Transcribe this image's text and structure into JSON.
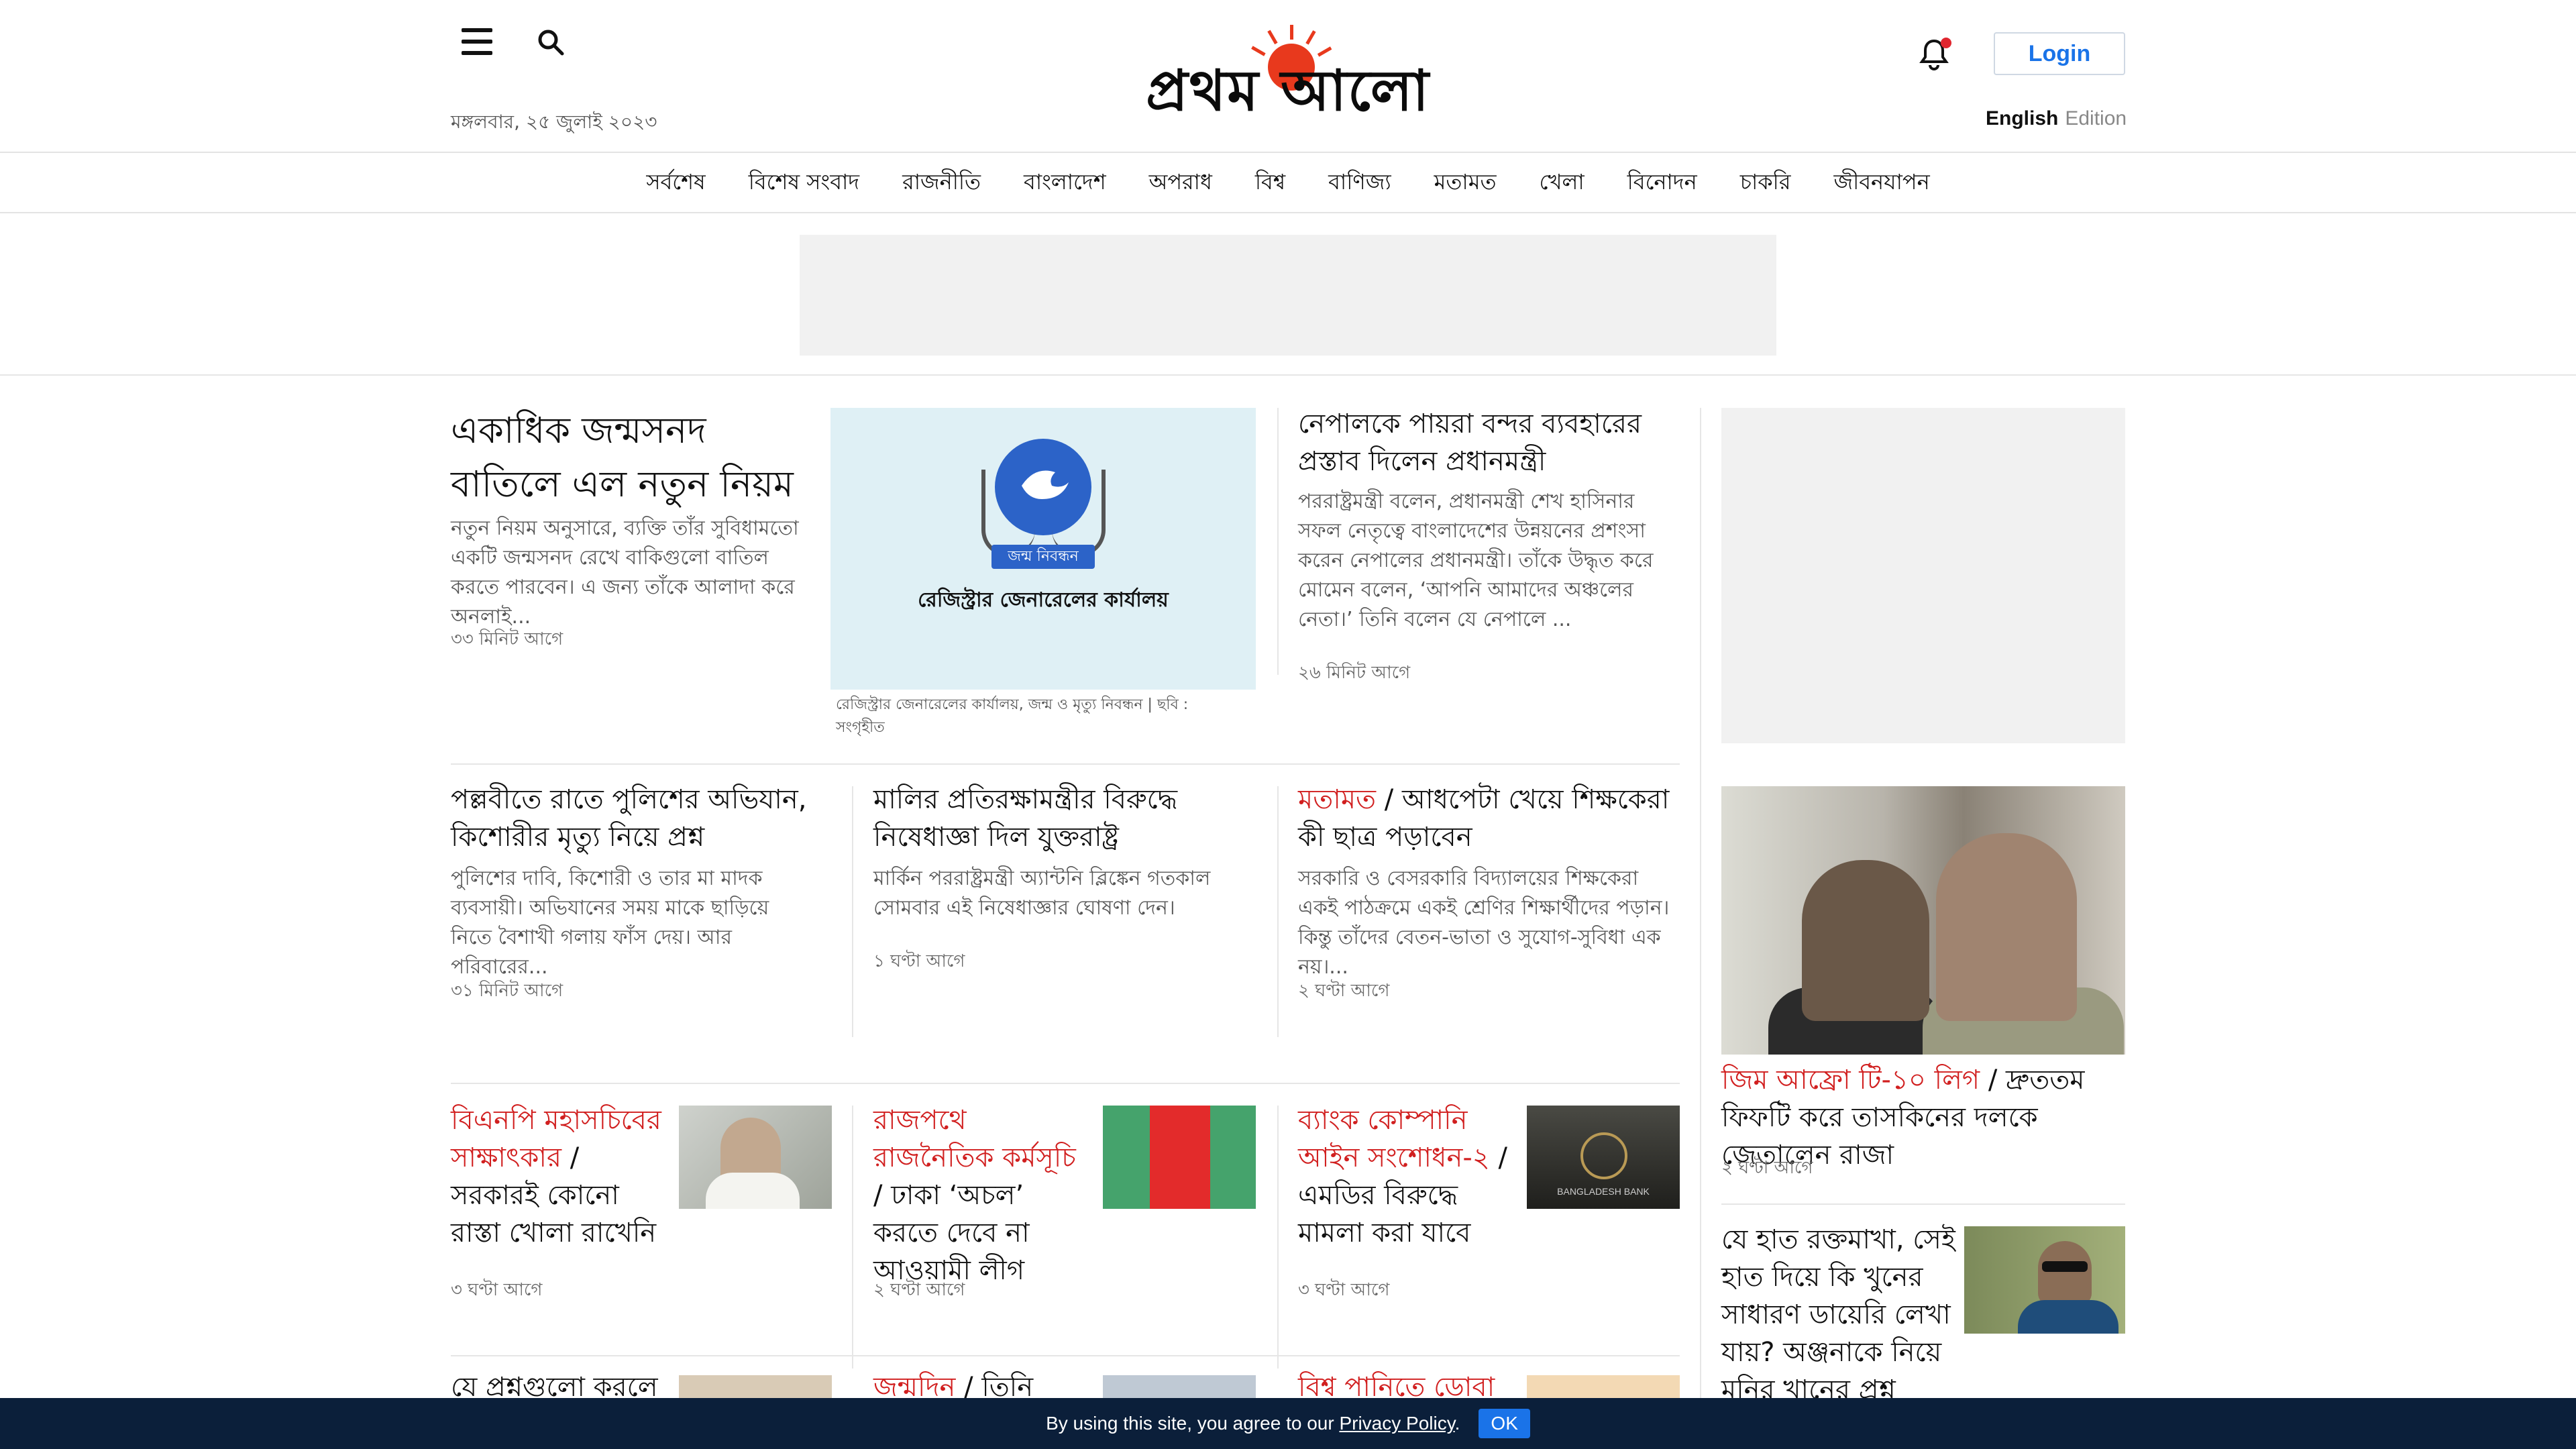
{
  "header": {
    "logo_text": "প্রথম আলো",
    "date": "মঙ্গলবার, ২৫ জুলাই ২০২৩",
    "login_label": "Login",
    "edition_english": "English",
    "edition_label": "Edition"
  },
  "nav": {
    "items": [
      "সর্বশেষ",
      "বিশেষ সংবাদ",
      "রাজনীতি",
      "বাংলাদেশ",
      "অপরাধ",
      "বিশ্ব",
      "বাণিজ্য",
      "মতামত",
      "খেলা",
      "বিনোদন",
      "চাকরি",
      "জীবনযাপন"
    ]
  },
  "lead": {
    "title": "একাধিক জন্মসনদ বাতিলে এল নতুন নিয়ম",
    "summary": "নতুন নিয়ম অনুসারে, ব্যক্তি তাঁর সুবিধামতো একটি জন্মসনদ রেখে বাকিগুলো বাতিল করতে পারবেন। এ জন্য তাঁকে আলাদা করে অনলাই...",
    "time": "৩৩ মিনিট আগে",
    "image_ribbon": "জন্ম নিবন্ধন",
    "image_org": "রেজিস্ট্রার জেনারেলের কার্যালয়",
    "caption": "রেজিস্ট্রার জেনারেলের কার্যালয়, জন্ম ও মৃত্যু নিবন্ধন | ছবি : সংগৃহীত"
  },
  "side_story": {
    "title": "নেপালকে পায়রা বন্দর ব্যবহারের প্রস্তাব দিলেন প্রধানমন্ত্রী",
    "summary": "পররাষ্ট্রমন্ত্রী বলেন, প্রধানমন্ত্রী শেখ হাসিনার সফল নেতৃত্বে বাংলাদেশের উন্নয়নের প্রশংসা করেন নেপালের প্রধানমন্ত্রী। তাঁকে উদ্ধৃত করে মোমেন বলেন, ‘আপনি আমাদের অঞ্চলের নেতা।’ তিনি বলেন যে নেপালে ...",
    "time": "২৬ মিনিট আগে"
  },
  "row2": [
    {
      "title": "পল্লবীতে রাতে পুলিশের অভিযান, কিশোরীর মৃত্যু নিয়ে প্রশ্ন",
      "summary": "পুলিশের দাবি, কিশোরী ও তার মা মাদক ব্যবসায়ী। অভিযানের সময় মাকে ছাড়িয়ে নিতে বৈশাখী গলায় ফাঁস দেয়। আর পরিবারের...",
      "time": "৩১ মিনিট আগে"
    },
    {
      "title": "মালির প্রতিরক্ষামন্ত্রীর বিরুদ্ধে নিষেধাজ্ঞা দিল যুক্তরাষ্ট্র",
      "summary": "মার্কিন পররাষ্ট্রমন্ত্রী অ্যান্টনি ব্লিঙ্কেন গতকাল সোমবার এই নিষেধাজ্ঞার ঘোষণা দেন।",
      "time": "১ ঘণ্টা আগে"
    },
    {
      "kicker": "মতামত",
      "title": "আধপেটা খেয়ে শিক্ষকেরা কী ছাত্র পড়াবেন",
      "summary": "সরকারি ও বেসরকারি বিদ্যালয়ের শিক্ষকেরা একই পাঠক্রমে একই শ্রেণির শিক্ষার্থীদের পড়ান। কিন্তু তাঁদের বেতন-ভাতা ও সুযোগ-সুবিধা এক নয়।...",
      "time": "২ ঘণ্টা আগে"
    }
  ],
  "row3": [
    {
      "kicker": "বিএনপি মহাসচিবের সাক্ষাৎকার",
      "title": "সরকারই কোনো রাস্তা খোলা রাখেনি",
      "time": "৩ ঘণ্টা আগে"
    },
    {
      "kicker": "রাজপথে রাজনৈতিক কর্মসূচি",
      "title": "ঢাকা ‘অচল’ করতে দেবে না আওয়ামী লীগ",
      "time": "২ ঘণ্টা আগে"
    },
    {
      "kicker": "ব্যাংক কোম্পানি আইন সংশোধন-২",
      "title": "এমডির বিরুদ্ধে মামলা করা যাবে",
      "time": "৩ ঘণ্টা আগে"
    }
  ],
  "row4": [
    {
      "title": "যে প্রশ্নগুলো করলে"
    },
    {
      "kicker": "জন্মদিন",
      "title": "তিনি উন্নত"
    },
    {
      "kicker": "বিশ্ব পানিতে ডোবা"
    }
  ],
  "right_col": {
    "photo_story": {
      "kicker": "জিম আফ্রো টি-১০ লিগ",
      "title": "দ্রুততম ফিফটি করে তাসকিনের দলকে জেতালেন রাজা",
      "time": "২ ঘণ্টা আগে"
    },
    "story2": {
      "title": "যে হাত রক্তমাখা, সেই হাত দিয়ে কি খুনের সাধারণ ডায়েরি লেখা যায়? অঞ্জনাকে নিয়ে মনির খানের প্রশ্ন"
    }
  },
  "footer": {
    "text": "By using this site, you agree to our",
    "policy": "Privacy Policy",
    "ok": "OK"
  },
  "thumb3_label": "BANGLADESH BANK",
  "colors": {
    "accent_red": "#d11f1f",
    "login_blue": "#1a73e8",
    "footer_bg": "#0b1f3a",
    "logo_sun": "#e8391d"
  }
}
